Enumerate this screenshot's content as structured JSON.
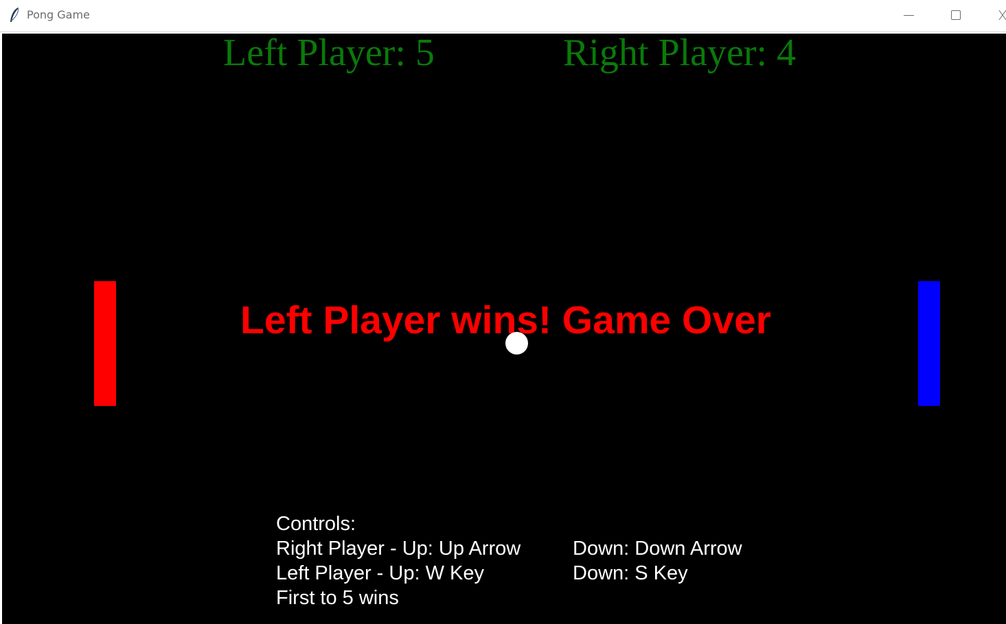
{
  "window": {
    "title": "Pong Game",
    "icon": "feather-icon",
    "controls": [
      "minimize-icon",
      "maximize-icon",
      "close-icon"
    ]
  },
  "scores": {
    "left": "Left Player: 5",
    "right": "Right Player: 4",
    "color": "#0a7a0a"
  },
  "message": {
    "text": "Left Player wins! Game Over",
    "color": "#ff0000"
  },
  "paddles": {
    "left_color": "#ff0000",
    "right_color": "#0000ff"
  },
  "ball": {
    "color": "#ffffff"
  },
  "controls": {
    "heading": "Controls:",
    "right_up": "Right Player - Up: Up Arrow",
    "right_down": "Down: Down Arrow",
    "left_up": "Left Player - Up: W Key",
    "left_down": "Down: S Key",
    "rule": "First to 5 wins"
  },
  "colors": {
    "background": "#000000",
    "text": "#ffffff"
  }
}
